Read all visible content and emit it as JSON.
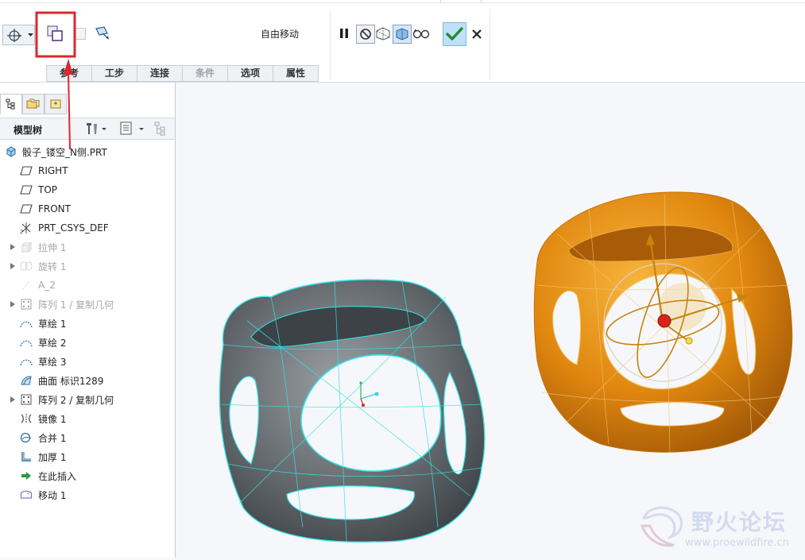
{
  "toolbar": {
    "mode_label": "自由移动",
    "tabs": [
      {
        "label": "参考",
        "enabled": true
      },
      {
        "label": "工步",
        "enabled": true
      },
      {
        "label": "连接",
        "enabled": true
      },
      {
        "label": "条件",
        "enabled": false
      },
      {
        "label": "选项",
        "enabled": true
      },
      {
        "label": "属性",
        "enabled": true
      }
    ],
    "icons": [
      "csys-drag-icon",
      "dropdown-arrow-icon",
      "create-new-copy-icon",
      "checkbox-icon",
      "move-component-icon",
      "pause-icon",
      "no-preview-icon",
      "geometry-preview-icon",
      "verify-icon",
      "glasses-icon",
      "confirm-check-icon",
      "cancel-x-icon"
    ],
    "accent_color": "#2f9ad6",
    "highlight_box_color": "#d9282f"
  },
  "panel": {
    "title": "模型树",
    "tab_icons": [
      "model-tree-icon",
      "folder-browser-icon",
      "favorites-icon"
    ],
    "header_icons": [
      "tree-settings-icon",
      "tree-columns-icon",
      "tree-filter-icon"
    ]
  },
  "tree": {
    "items": [
      {
        "label": "骰子_镂空_N侧.PRT",
        "icon": "part-icon",
        "expand": false,
        "dim": false,
        "indent": 0
      },
      {
        "label": "RIGHT",
        "icon": "datum-plane-icon",
        "expand": false,
        "dim": false,
        "indent": 1
      },
      {
        "label": "TOP",
        "icon": "datum-plane-icon",
        "expand": false,
        "dim": false,
        "indent": 1
      },
      {
        "label": "FRONT",
        "icon": "datum-plane-icon",
        "expand": false,
        "dim": false,
        "indent": 1
      },
      {
        "label": "PRT_CSYS_DEF",
        "icon": "csys-icon",
        "expand": false,
        "dim": false,
        "indent": 1
      },
      {
        "label": "拉伸 1",
        "icon": "extrude-icon",
        "expand": true,
        "dim": true,
        "indent": 1
      },
      {
        "label": "旋转 1",
        "icon": "revolve-icon",
        "expand": true,
        "dim": true,
        "indent": 1
      },
      {
        "label": "A_2",
        "icon": "axis-icon",
        "expand": false,
        "dim": true,
        "indent": 1
      },
      {
        "label": "阵列 1 / 复制几何",
        "icon": "pattern-icon",
        "expand": true,
        "dim": true,
        "indent": 1
      },
      {
        "label": "草绘 1",
        "icon": "sketch-icon",
        "expand": false,
        "dim": false,
        "indent": 1
      },
      {
        "label": "草绘 2",
        "icon": "sketch-icon",
        "expand": false,
        "dim": false,
        "indent": 1
      },
      {
        "label": "草绘 3",
        "icon": "sketch-icon",
        "expand": false,
        "dim": false,
        "indent": 1
      },
      {
        "label": "曲面 标识1289",
        "icon": "surface-icon",
        "expand": false,
        "dim": false,
        "indent": 1
      },
      {
        "label": "阵列 2 / 复制几何",
        "icon": "pattern-icon",
        "expand": true,
        "dim": false,
        "indent": 1
      },
      {
        "label": "镜像 1",
        "icon": "mirror-icon",
        "expand": false,
        "dim": false,
        "indent": 1
      },
      {
        "label": "合并 1",
        "icon": "merge-icon",
        "expand": false,
        "dim": false,
        "indent": 1
      },
      {
        "label": "加厚 1",
        "icon": "thicken-icon",
        "expand": false,
        "dim": false,
        "indent": 1
      },
      {
        "label": "在此插入",
        "icon": "insert-here-icon",
        "expand": false,
        "dim": false,
        "indent": 1
      },
      {
        "label": "移动 1",
        "icon": "move-feature-icon",
        "expand": false,
        "dim": false,
        "indent": 1
      }
    ]
  },
  "viewport": {
    "gray_model_color": "#5f6468",
    "edge_color": "#35e3e8",
    "orange_model_color": "#e38a14",
    "dragger_color": "#c9820c",
    "origin_dot_color": "#d8251b"
  },
  "watermark": {
    "title": "野火论坛",
    "url": "www.proewildfire.cn"
  }
}
